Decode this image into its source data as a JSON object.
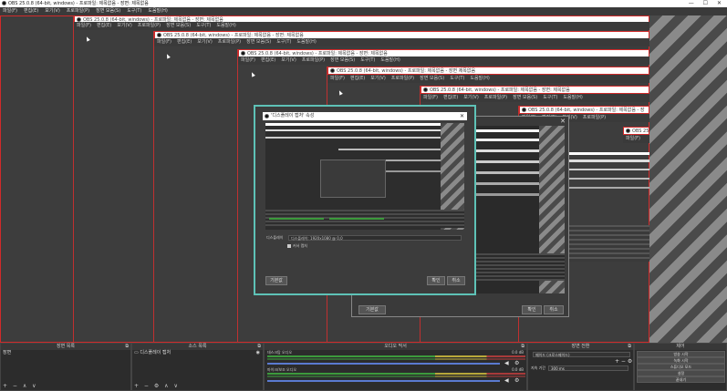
{
  "window": {
    "title": "OBS 25.0.8 (64-bit, windows) - 프로파일: 제목없음 - 장면: 제목없음",
    "controls": "—  ☐  ✕"
  },
  "menubar": [
    "파일(F)",
    "편집(E)",
    "보기(V)",
    "프로파일(P)",
    "장면 모음(S)",
    "도구(T)",
    "도움말(H)"
  ],
  "nested": {
    "title_1": "OBS 25.0.8 (64-bit, windows) - 프로파일: 제목없음 - 장면: 제목없음",
    "title_2": "OBS 25.0.8 (64-bit, windows) - 프로파일: 제목없음 - 장면: 제목없음",
    "title_3": "OBS 25.0.8 (64-bit, windows) - 프로파일: 제목없음 - 장면: 제목없음",
    "title_4": "OBS 25.0.8 (64-bit, windows) - 프로파일: 제목없음 - 장면 제목없음",
    "title_5": "OBS 25.0.8 (64-bit, windows) - 프로파일: 제목없음 - 장면: 제목없음",
    "title_6": "OBS 25.0.8 (64-bit, windows) - 프로파일: 제목없음 - 장",
    "title_7": "OBS 25."
  },
  "dialog": {
    "title": "'디스플레이 캡처' 속성",
    "close": "✕",
    "display_label": "디스플레이",
    "display_value": "디스플레이: 1920x1080 @ 0,0",
    "capture_cursor": "커서 캡처",
    "defaults_button": "기본값",
    "ok_button": "확인",
    "cancel_button": "취소"
  },
  "bg_dialog": {
    "defaults_button": "기본값",
    "ok_button": "확인",
    "cancel_button": "취소"
  },
  "docks": {
    "scenes": {
      "title": "장면 목록",
      "item": "장면",
      "footer": "+ − ∧ ∨"
    },
    "sources": {
      "title": "소스 목록",
      "item": "디스플레이 캡처",
      "footer": "+ − ⚙ ∧ ∨"
    },
    "mixer": {
      "title": "오디오 믹서",
      "tracks": [
        {
          "name": "데스크탑 오디오",
          "level": "0.0 dB"
        },
        {
          "name": "마이크/보조 오디오",
          "level": "0.0 dB"
        }
      ]
    },
    "transitions": {
      "title": "장면 전환",
      "type": "페이드 (크로스페이드)",
      "duration_label": "지속 기간",
      "duration_value": "300 ms"
    },
    "controls": {
      "title": "제어",
      "buttons": [
        "방송 시작",
        "녹화 시작",
        "스튜디오 모드",
        "설정",
        "끝내기"
      ]
    }
  },
  "colors": {
    "frame_red": "#d12a2a",
    "dialog_border": "#5ec2b7",
    "bg": "#2b2b2b"
  }
}
